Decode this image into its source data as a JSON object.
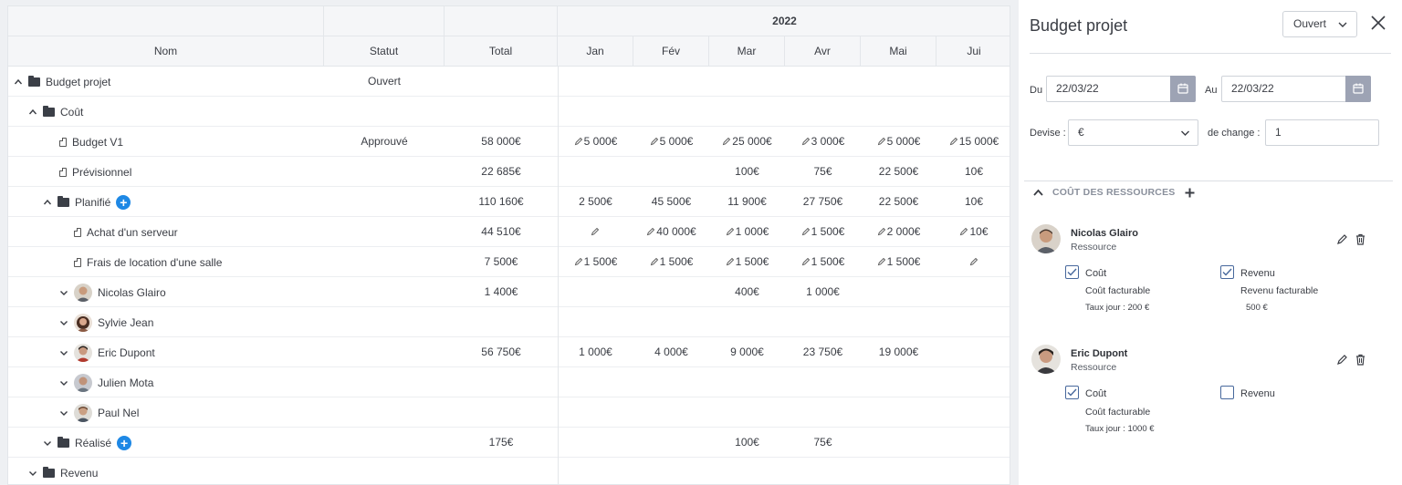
{
  "grid": {
    "year": "2022",
    "headers": {
      "nom": "Nom",
      "statut": "Statut",
      "total": "Total"
    },
    "months": [
      "Jan",
      "Fév",
      "Mar",
      "Avr",
      "Mai",
      "Jui"
    ],
    "rows": [
      {
        "label": "Budget projet",
        "statut": "Ouvert",
        "total": "",
        "m": [
          "",
          "",
          "",
          "",
          "",
          ""
        ]
      },
      {
        "label": "Coût",
        "statut": "",
        "total": "",
        "m": [
          "",
          "",
          "",
          "",
          "",
          ""
        ]
      },
      {
        "label": "Budget V1",
        "statut": "Approuvé",
        "total": "58 000€",
        "m": [
          "5 000€",
          "5 000€",
          "25 000€",
          "3 000€",
          "5 000€",
          "15 000€"
        ]
      },
      {
        "label": "Prévisionnel",
        "statut": "",
        "total": "22 685€",
        "m": [
          "",
          "",
          "100€",
          "75€",
          "22 500€",
          "10€"
        ]
      },
      {
        "label": "Planifié",
        "statut": "",
        "total": "110 160€",
        "m": [
          "2 500€",
          "45 500€",
          "11 900€",
          "27 750€",
          "22 500€",
          "10€"
        ]
      },
      {
        "label": "Achat d'un serveur",
        "statut": "",
        "total": "44 510€",
        "m": [
          "",
          "40 000€",
          "1 000€",
          "1 500€",
          "2 000€",
          "10€"
        ]
      },
      {
        "label": "Frais de location d'une salle",
        "statut": "",
        "total": "7 500€",
        "m": [
          "1 500€",
          "1 500€",
          "1 500€",
          "1 500€",
          "1 500€",
          ""
        ]
      },
      {
        "label": "Nicolas Glairo",
        "statut": "",
        "total": "1 400€",
        "m": [
          "",
          "",
          "400€",
          "1 000€",
          "",
          ""
        ]
      },
      {
        "label": "Sylvie Jean",
        "statut": "",
        "total": "",
        "m": [
          "",
          "",
          "",
          "",
          "",
          ""
        ]
      },
      {
        "label": "Eric Dupont",
        "statut": "",
        "total": "56 750€",
        "m": [
          "1 000€",
          "4 000€",
          "9 000€",
          "23 750€",
          "19 000€",
          ""
        ]
      },
      {
        "label": "Julien Mota",
        "statut": "",
        "total": "",
        "m": [
          "",
          "",
          "",
          "",
          "",
          ""
        ]
      },
      {
        "label": "Paul Nel",
        "statut": "",
        "total": "",
        "m": [
          "",
          "",
          "",
          "",
          "",
          ""
        ]
      },
      {
        "label": "Réalisé",
        "statut": "",
        "total": "175€",
        "m": [
          "",
          "",
          "100€",
          "75€",
          "",
          ""
        ]
      },
      {
        "label": "Revenu",
        "statut": "",
        "total": "",
        "m": [
          "",
          "",
          "",
          "",
          "",
          ""
        ]
      }
    ]
  },
  "panel": {
    "title": "Budget projet",
    "status": "Ouvert",
    "du_label": "Du",
    "du_value": "22/03/22",
    "au_label": "Au",
    "au_value": "22/03/22",
    "devise_label": "Devise :",
    "devise_value": "€",
    "change_label": "de change :",
    "change_value": "1",
    "section_title": "COÛT DES RESSOURCES",
    "resources": [
      {
        "name": "Nicolas Glairo",
        "role": "Ressource",
        "cout_label": "Coût",
        "cout_checked": true,
        "cout_fact": "Coût facturable",
        "taux": "Taux jour :  200  €",
        "revenu_label": "Revenu",
        "revenu_checked": true,
        "revenu_fact": "Revenu facturable",
        "revenu_val": "500  €"
      },
      {
        "name": "Eric Dupont",
        "role": "Ressource",
        "cout_label": "Coût",
        "cout_checked": true,
        "cout_fact": "Coût facturable",
        "taux": "Taux jour :  1000  €",
        "revenu_label": "Revenu",
        "revenu_checked": false
      }
    ]
  },
  "colors": {
    "accent": "#1e88e5",
    "checkbox": "#47689c",
    "calendar_btn": "#9da3b4"
  }
}
